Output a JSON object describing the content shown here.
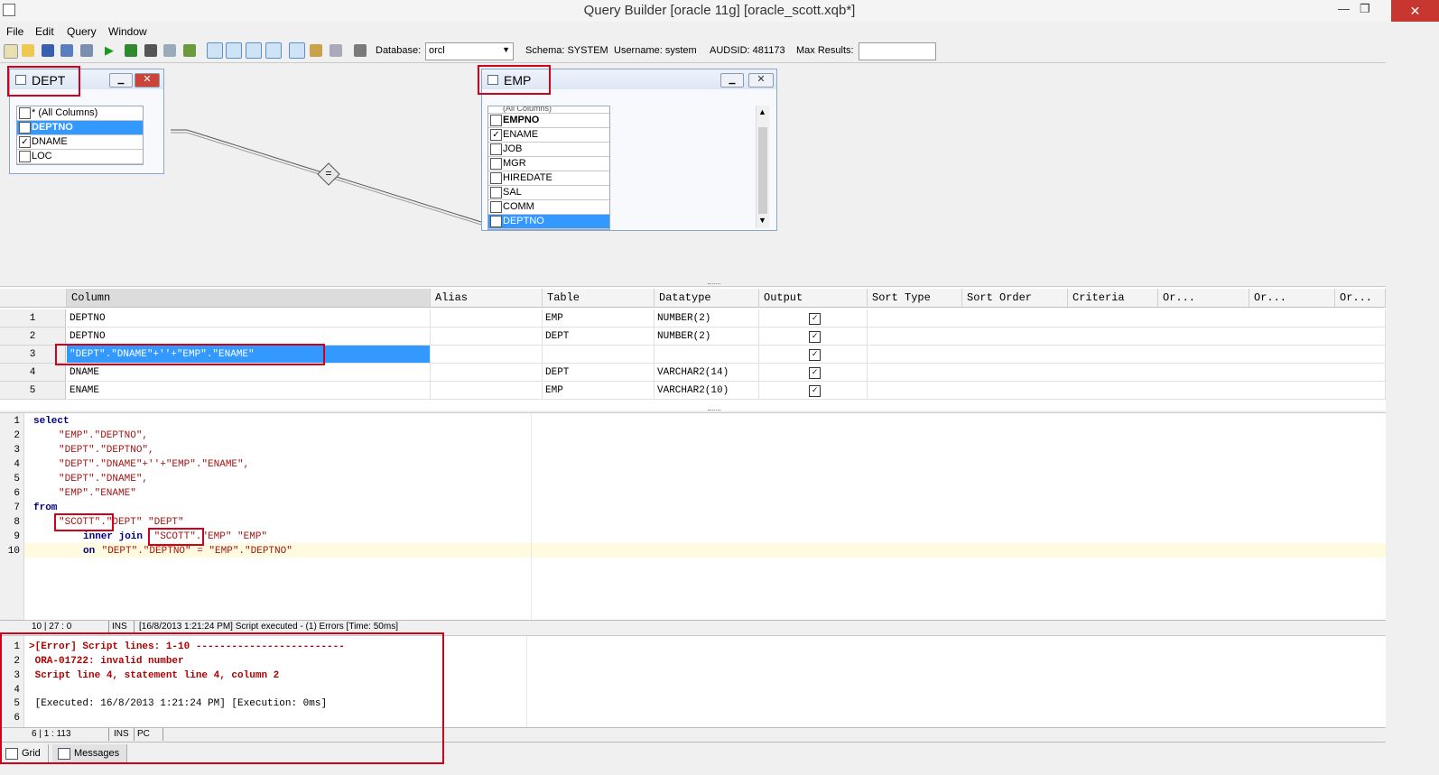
{
  "window": {
    "title": "Query Builder [oracle 11g] [oracle_scott.xqb*]"
  },
  "menu": [
    "File",
    "Edit",
    "Query",
    "Window"
  ],
  "toolbar": {
    "database_label": "Database:",
    "database_value": "orcl",
    "schema": "Schema:  SYSTEM",
    "username": "Username:  system",
    "audsid": "AUDSID:  481173",
    "max_results_label": "Max Results:",
    "max_results_value": ""
  },
  "diagram": {
    "join_symbol": "=",
    "tables": [
      {
        "name": "DEPT",
        "columns": [
          {
            "label": "* (All Columns)",
            "checked": false
          },
          {
            "label": "DEPTNO",
            "checked": true,
            "selected": true
          },
          {
            "label": "DNAME",
            "checked": true
          },
          {
            "label": "LOC",
            "checked": false
          }
        ]
      },
      {
        "name": "EMP",
        "columns": [
          {
            "label": "(All Columns)",
            "checked": false
          },
          {
            "label": "EMPNO",
            "checked": false,
            "bold": true
          },
          {
            "label": "ENAME",
            "checked": true
          },
          {
            "label": "JOB",
            "checked": false
          },
          {
            "label": "MGR",
            "checked": false
          },
          {
            "label": "HIREDATE",
            "checked": false
          },
          {
            "label": "SAL",
            "checked": false
          },
          {
            "label": "COMM",
            "checked": false
          },
          {
            "label": "DEPTNO",
            "checked": true,
            "selected": true
          }
        ]
      }
    ]
  },
  "grid": {
    "headers": [
      "Column",
      "Alias",
      "Table",
      "Datatype",
      "Output",
      "Sort Type",
      "Sort Order",
      "Criteria",
      "Or...",
      "Or...",
      "Or..."
    ],
    "rows": [
      {
        "n": "1",
        "column": "DEPTNO",
        "alias": "",
        "table": "EMP",
        "datatype": "NUMBER(2)",
        "output": true
      },
      {
        "n": "2",
        "column": "DEPTNO",
        "alias": "",
        "table": "DEPT",
        "datatype": "NUMBER(2)",
        "output": true
      },
      {
        "n": "3",
        "column": "\"DEPT\".\"DNAME\"+''+\"EMP\".\"ENAME\"",
        "alias": "",
        "table": "",
        "datatype": "",
        "output": true,
        "selected": true
      },
      {
        "n": "4",
        "column": "DNAME",
        "alias": "",
        "table": "DEPT",
        "datatype": "VARCHAR2(14)",
        "output": true
      },
      {
        "n": "5",
        "column": "ENAME",
        "alias": "",
        "table": "EMP",
        "datatype": "VARCHAR2(10)",
        "output": true
      }
    ]
  },
  "sql": {
    "lines": [
      {
        "n": "1",
        "indent": "",
        "kw": "select",
        "text": ""
      },
      {
        "n": "2",
        "indent": "    ",
        "kw": "",
        "text": "\"EMP\".\"DEPTNO\","
      },
      {
        "n": "3",
        "indent": "    ",
        "kw": "",
        "text": "\"DEPT\".\"DEPTNO\","
      },
      {
        "n": "4",
        "indent": "    ",
        "kw": "",
        "text": "\"DEPT\".\"DNAME\"+''+\"EMP\".\"ENAME\","
      },
      {
        "n": "5",
        "indent": "    ",
        "kw": "",
        "text": "\"DEPT\".\"DNAME\","
      },
      {
        "n": "6",
        "indent": "    ",
        "kw": "",
        "text": "\"EMP\".\"ENAME\""
      },
      {
        "n": "7",
        "indent": "",
        "kw": "from",
        "text": ""
      },
      {
        "n": "8",
        "indent": "    ",
        "kw": "",
        "text": "\"SCOTT\".\"DEPT\" \"DEPT\""
      },
      {
        "n": "9",
        "indent": "        ",
        "kw": "inner join",
        "text": " \"SCOTT\".\"EMP\" \"EMP\""
      },
      {
        "n": "10",
        "indent": "        ",
        "kw": "on",
        "text": " \"DEPT\".\"DEPTNO\" = \"EMP\".\"DEPTNO\""
      }
    ],
    "status_pos": "10 | 27 : 0",
    "status_mode": "INS",
    "status_msg": "[16/8/2013 1:21:24 PM] Script executed - (1) Errors [Time: 50ms]"
  },
  "messages": {
    "lines": [
      {
        "n": "1",
        "text": ">[Error] Script lines: 1-10 -------------------------"
      },
      {
        "n": "2",
        "text": " ORA-01722: invalid number"
      },
      {
        "n": "3",
        "text": " Script line 4, statement line 4, column 2"
      },
      {
        "n": "4",
        "text": ""
      },
      {
        "n": "5",
        "text": " [Executed: 16/8/2013 1:21:24 PM] [Execution: 0ms]"
      },
      {
        "n": "6",
        "text": ""
      }
    ],
    "status_pos": "6 | 1 : 113",
    "status_mode": "INS",
    "status_pc": "PC"
  },
  "bottom_tabs": [
    "Grid",
    "Messages"
  ],
  "colors": {
    "accent_red": "#d0021b",
    "selection_blue": "#3399ff"
  }
}
